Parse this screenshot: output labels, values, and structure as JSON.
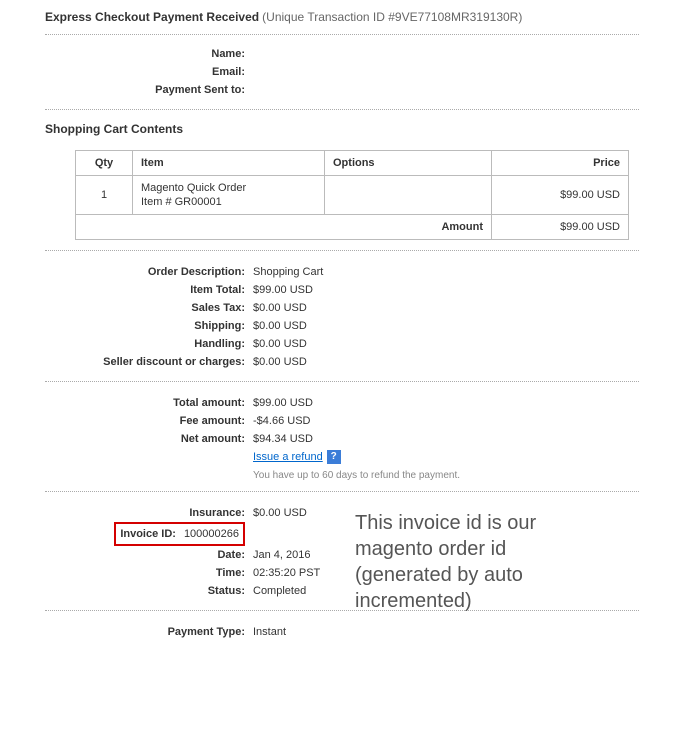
{
  "header": {
    "title_bold": "Express Checkout Payment Received",
    "transaction_prefix": "(Unique Transaction ID #",
    "transaction_id": "9VE77108MR319130R",
    "transaction_suffix": ")"
  },
  "buyer": {
    "name_label": "Name:",
    "name_value": "",
    "email_label": "Email:",
    "email_value": "",
    "sent_to_label": "Payment Sent to:",
    "sent_to_value": ""
  },
  "cart_section": {
    "heading": "Shopping Cart Contents",
    "headers": {
      "qty": "Qty",
      "item": "Item",
      "options": "Options",
      "price": "Price"
    },
    "rows": [
      {
        "qty": "1",
        "name": "Magento Quick Order",
        "sku": "Item # GR00001",
        "options": "",
        "price": "$99.00 USD"
      }
    ],
    "amount_label": "Amount",
    "amount_value": "$99.00 USD"
  },
  "order": {
    "desc_label": "Order Description:",
    "desc_value": "Shopping Cart",
    "item_total_label": "Item Total:",
    "item_total_value": "$99.00 USD",
    "sales_tax_label": "Sales Tax:",
    "sales_tax_value": "$0.00 USD",
    "shipping_label": "Shipping:",
    "shipping_value": "$0.00 USD",
    "handling_label": "Handling:",
    "handling_value": "$0.00 USD",
    "seller_disc_label": "Seller discount or charges:",
    "seller_disc_value": "$0.00 USD"
  },
  "totals": {
    "total_label": "Total amount:",
    "total_value": "$99.00 USD",
    "fee_label": "Fee amount:",
    "fee_value": "-$4.66 USD",
    "net_label": "Net amount:",
    "net_value": "$94.34 USD",
    "refund_link": "Issue a refund",
    "refund_note": "You have up to 60 days to refund the payment."
  },
  "details": {
    "insurance_label": "Insurance:",
    "insurance_value": "$0.00 USD",
    "invoice_label": "Invoice ID:",
    "invoice_value": "100000266",
    "date_label": "Date:",
    "date_value": "Jan 4, 2016",
    "time_label": "Time:",
    "time_value": "02:35:20 PST",
    "status_label": "Status:",
    "status_value": "Completed"
  },
  "payment": {
    "type_label": "Payment Type:",
    "type_value": "Instant"
  },
  "annotation": "This invoice id is our magento order id (generated by auto incremented)"
}
